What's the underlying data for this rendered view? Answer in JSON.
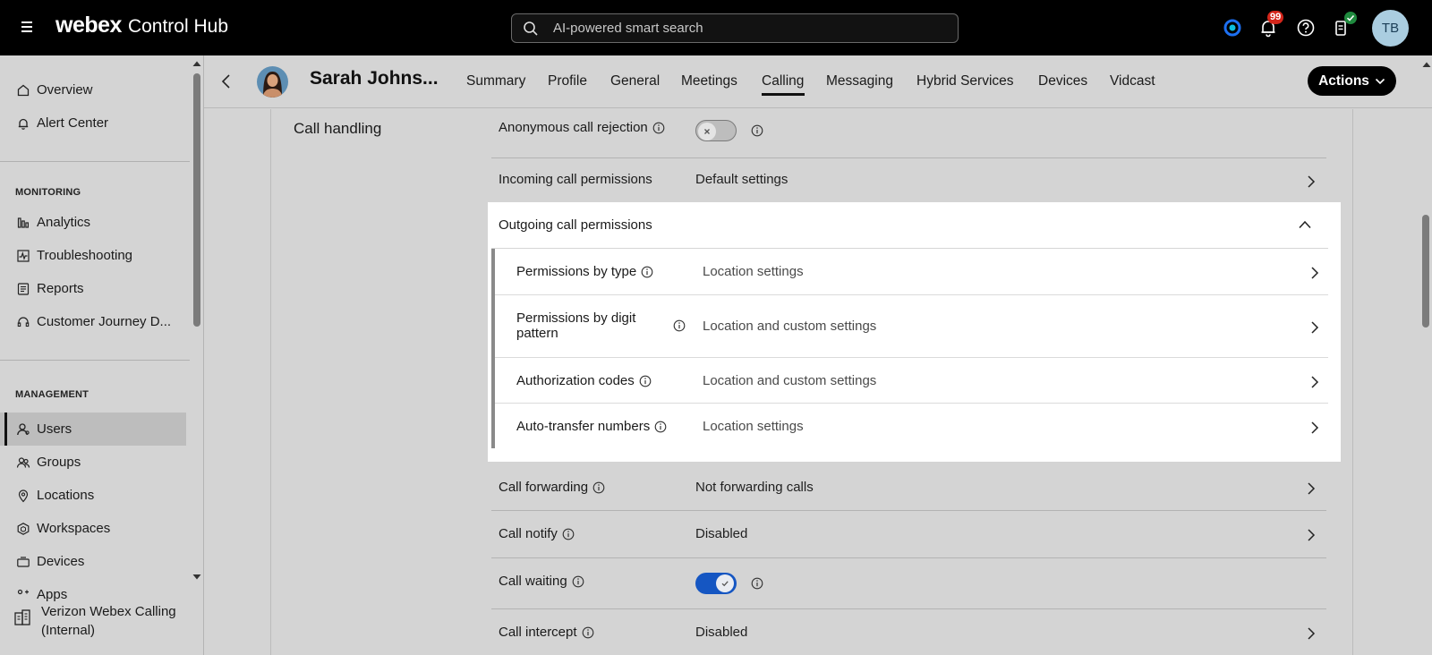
{
  "topbar": {
    "brand_webex": "webex",
    "brand_rest": "Control Hub",
    "search_placeholder": "AI-powered smart search",
    "notification_count": "99",
    "user_initials": "TB"
  },
  "sidebar": {
    "top_items": [
      {
        "label": "Overview",
        "icon": "home-icon"
      },
      {
        "label": "Alert Center",
        "icon": "bell-icon"
      }
    ],
    "monitoring_label": "MONITORING",
    "monitoring_items": [
      {
        "label": "Analytics",
        "icon": "bar-chart-icon"
      },
      {
        "label": "Troubleshooting",
        "icon": "pulse-icon"
      },
      {
        "label": "Reports",
        "icon": "report-icon"
      },
      {
        "label": "Customer Journey D...",
        "icon": "headset-icon"
      }
    ],
    "management_label": "MANAGEMENT",
    "management_items": [
      {
        "label": "Users",
        "icon": "user-icon",
        "active": true
      },
      {
        "label": "Groups",
        "icon": "group-icon"
      },
      {
        "label": "Locations",
        "icon": "location-pin-icon"
      },
      {
        "label": "Workspaces",
        "icon": "workspace-icon"
      },
      {
        "label": "Devices",
        "icon": "device-icon"
      },
      {
        "label": "Apps",
        "icon": "apps-icon"
      }
    ],
    "org_label": "Verizon Webex Calling (Internal)"
  },
  "subheader": {
    "user_name": "Sarah Johns...",
    "tabs": [
      "Summary",
      "Profile",
      "General",
      "Meetings",
      "Calling",
      "Messaging",
      "Hybrid Services",
      "Devices",
      "Vidcast"
    ],
    "active_tab": "Calling",
    "actions_label": "Actions"
  },
  "content": {
    "section_title": "Call handling",
    "rows_top": [
      {
        "label": "Anonymous call rejection",
        "type": "toggle",
        "on": false
      },
      {
        "label": "Incoming call permissions",
        "value": "Default settings"
      }
    ],
    "outgoing": {
      "label": "Outgoing call permissions",
      "sub_rows": [
        {
          "label": "Permissions by type",
          "value": "Location settings"
        },
        {
          "label": "Permissions by digit pattern",
          "value": "Location and custom settings"
        },
        {
          "label": "Authorization codes",
          "value": "Location and custom settings"
        },
        {
          "label": "Auto-transfer numbers",
          "value": "Location settings"
        }
      ]
    },
    "rows_bottom": [
      {
        "label": "Call forwarding",
        "value": "Not forwarding calls"
      },
      {
        "label": "Call notify",
        "value": "Disabled"
      },
      {
        "label": "Call waiting",
        "type": "toggle",
        "on": true
      },
      {
        "label": "Call intercept",
        "value": "Disabled"
      }
    ]
  },
  "colors": {
    "topbar_bg": "#000000",
    "toggle_on": "#1556c2",
    "badge": "#d4261b"
  }
}
